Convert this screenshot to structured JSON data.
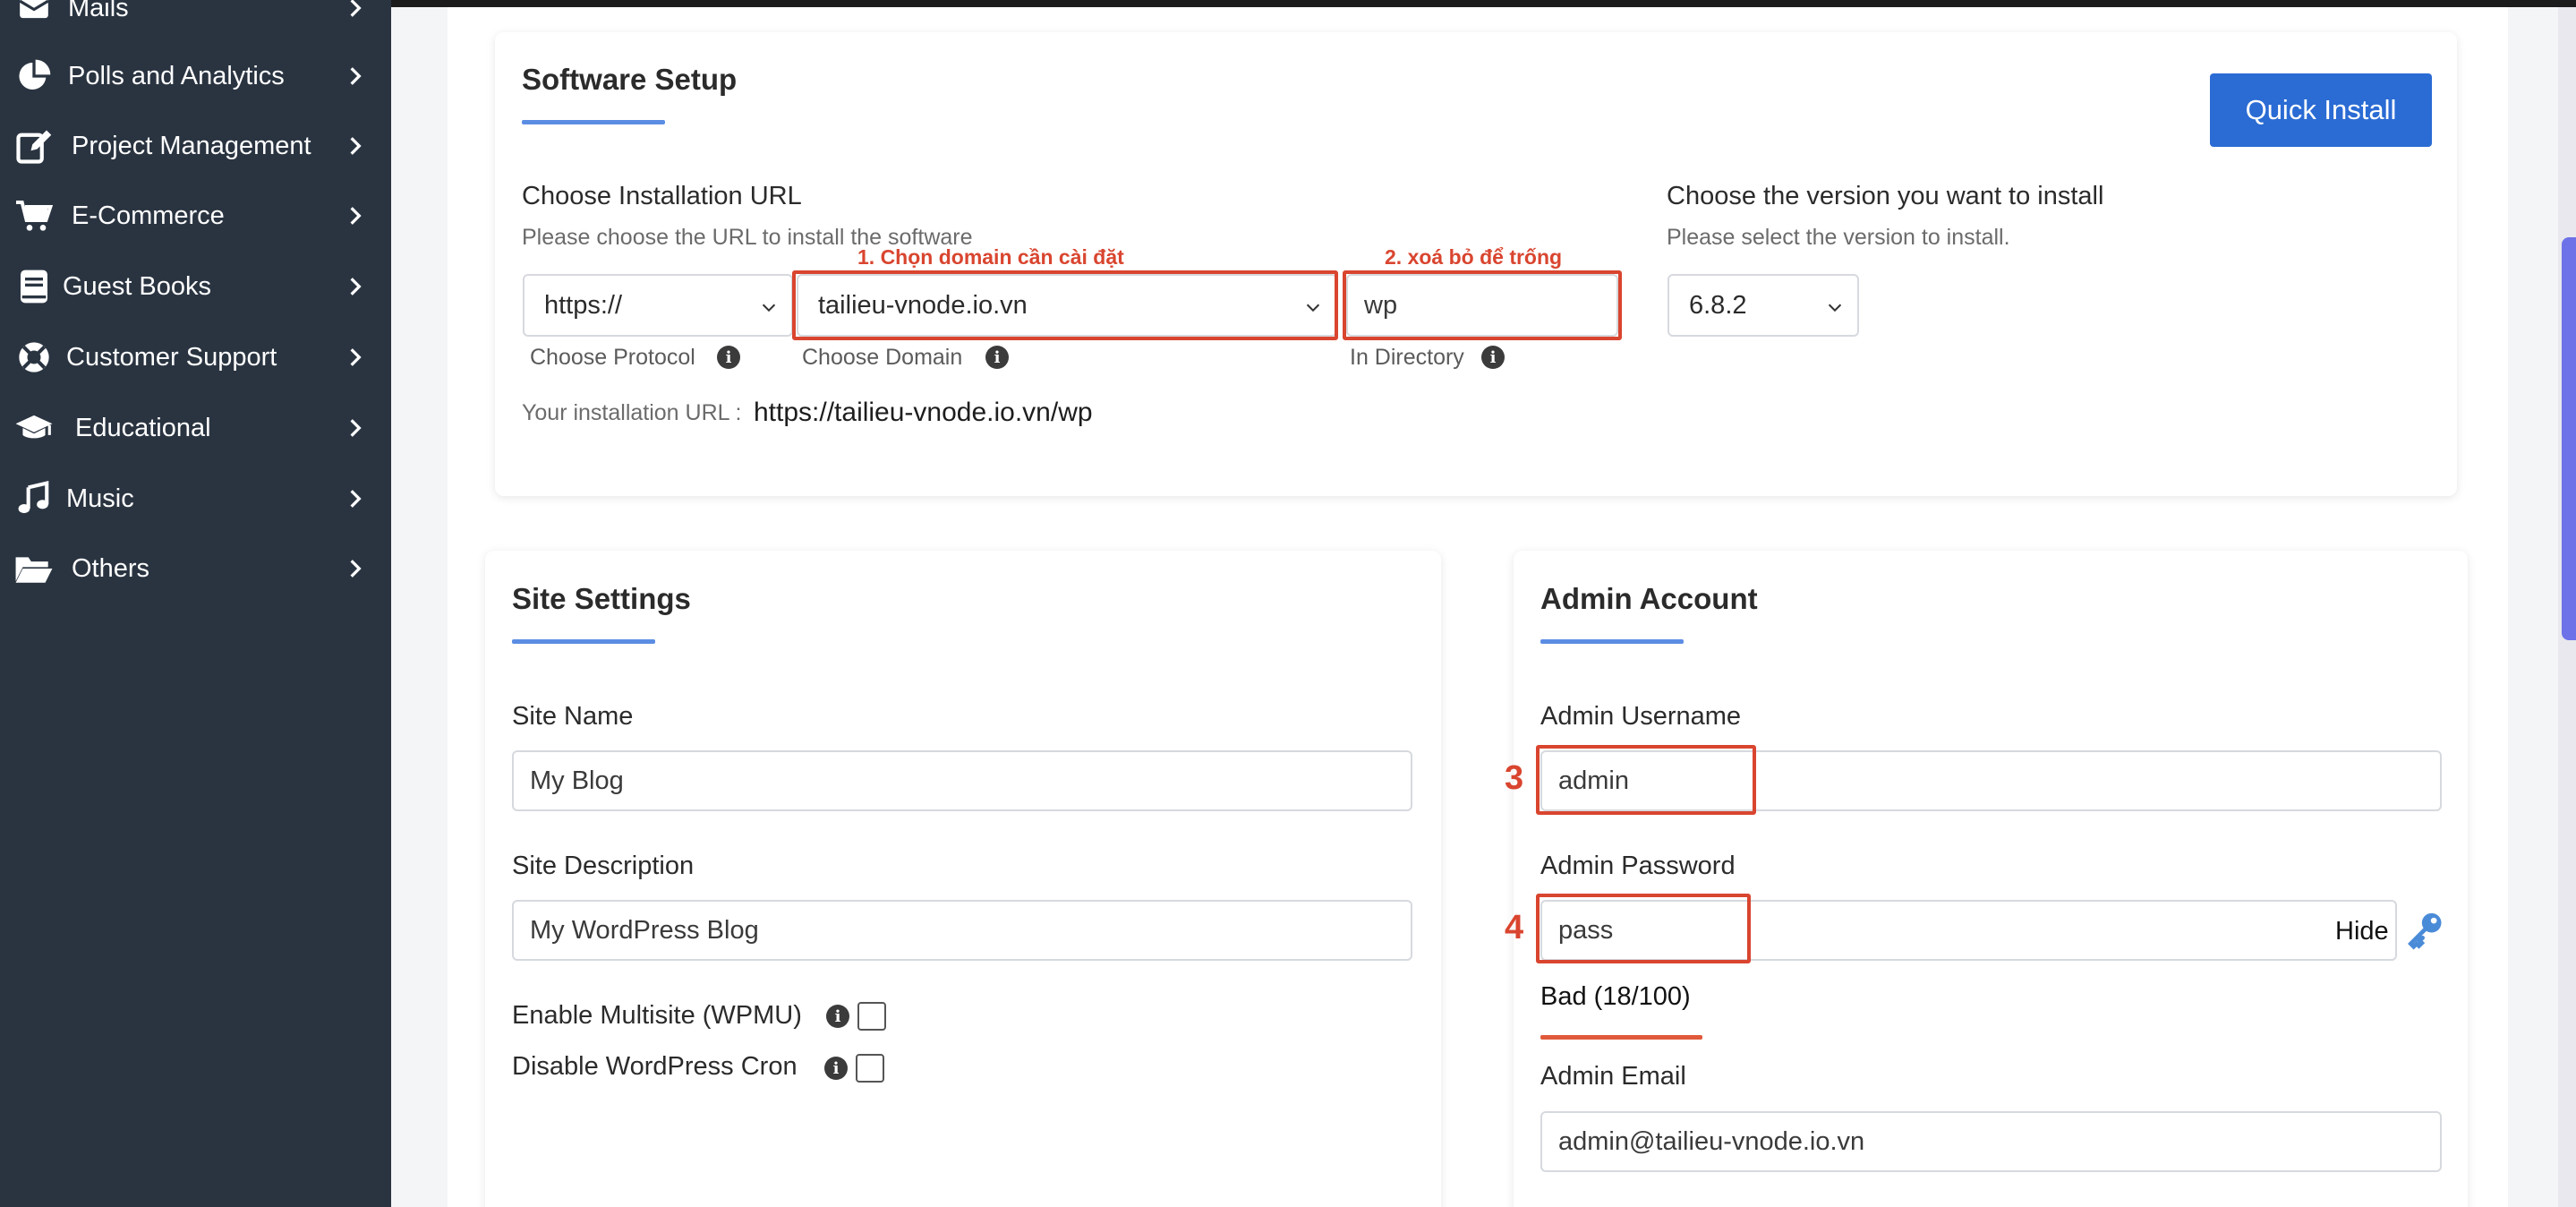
{
  "sidebar": {
    "items": [
      {
        "label": "Mails",
        "icon": "mail-icon"
      },
      {
        "label": "Polls and Analytics",
        "icon": "pie-chart-icon"
      },
      {
        "label": "Project Management",
        "icon": "edit-icon"
      },
      {
        "label": "E-Commerce",
        "icon": "cart-icon"
      },
      {
        "label": "Guest Books",
        "icon": "book-icon"
      },
      {
        "label": "Customer Support",
        "icon": "lifebuoy-icon"
      },
      {
        "label": "Educational",
        "icon": "graduation-cap-icon"
      },
      {
        "label": "Music",
        "icon": "music-note-icon"
      },
      {
        "label": "Others",
        "icon": "folder-open-icon"
      }
    ]
  },
  "software_setup": {
    "title": "Software Setup",
    "quick_install_label": "Quick Install",
    "install_url": {
      "heading": "Choose Installation URL",
      "hint": "Please choose the URL to install the software",
      "protocol_value": "https://",
      "protocol_label": "Choose Protocol",
      "domain_value": "tailieu-vnode.io.vn",
      "domain_label": "Choose Domain",
      "directory_value": "wp",
      "directory_label": "In Directory",
      "your_url_label": "Your installation URL :",
      "your_url_value": "https://tailieu-vnode.io.vn/wp"
    },
    "version": {
      "heading": "Choose the version you want to install",
      "hint": "Please select the version to install.",
      "value": "6.8.2"
    }
  },
  "annotations": {
    "step1": "1. Chọn domain cần cài đặt",
    "step2": "2. xoá bỏ để trống",
    "step3": "3",
    "step4": "4"
  },
  "site_settings": {
    "title": "Site Settings",
    "site_name_label": "Site Name",
    "site_name_value": "My Blog",
    "site_description_label": "Site Description",
    "site_description_value": "My WordPress Blog",
    "multisite_label": "Enable Multisite (WPMU)",
    "cron_label": "Disable WordPress Cron"
  },
  "admin_account": {
    "title": "Admin Account",
    "username_label": "Admin Username",
    "username_value": "admin",
    "password_label": "Admin Password",
    "password_value": "pass",
    "hide_label": "Hide",
    "strength_text": "Bad (18/100)",
    "strength_score": 18,
    "email_label": "Admin Email",
    "email_value": "admin@tailieu-vnode.io.vn"
  },
  "colors": {
    "sidebar_bg": "#2a3441",
    "accent": "#2a6bd4",
    "annotation": "#d9452f",
    "underline": "#5b8de3"
  }
}
